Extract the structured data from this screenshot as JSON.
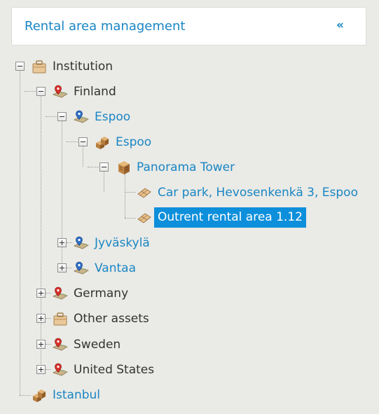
{
  "header": {
    "title": "Rental area management",
    "collapse_icon": "double-chevron-left-icon"
  },
  "tree": {
    "nodes": [
      {
        "id": "institution",
        "label": "Institution",
        "icon": "briefcase-icon",
        "expanded": true
      },
      {
        "id": "finland",
        "label": "Finland",
        "icon": "map-pin-red-icon",
        "expanded": true
      },
      {
        "id": "espoo-city",
        "label": "Espoo",
        "icon": "map-pin-blue-icon",
        "expanded": true
      },
      {
        "id": "espoo-site",
        "label": "Espoo",
        "icon": "buildings-icon",
        "expanded": true
      },
      {
        "id": "panorama-tower",
        "label": "Panorama Tower",
        "icon": "building-icon",
        "expanded": true
      },
      {
        "id": "car-park",
        "label": "Car park, Hevosenkenkä 3, Espoo",
        "icon": "floor-area-icon"
      },
      {
        "id": "outrent",
        "label": "Outrent rental area 1.12",
        "icon": "floor-area-icon",
        "selected": true
      },
      {
        "id": "jyvaskyla",
        "label": "Jyväskylä",
        "icon": "map-pin-blue-icon",
        "expanded": false
      },
      {
        "id": "vantaa",
        "label": "Vantaa",
        "icon": "map-pin-blue-icon",
        "expanded": false
      },
      {
        "id": "germany",
        "label": "Germany",
        "icon": "map-pin-red-icon",
        "expanded": false
      },
      {
        "id": "other-assets",
        "label": "Other assets",
        "icon": "briefcase-icon",
        "expanded": false
      },
      {
        "id": "sweden",
        "label": "Sweden",
        "icon": "map-pin-red-icon",
        "expanded": false
      },
      {
        "id": "united-states",
        "label": "United States",
        "icon": "map-pin-red-icon",
        "expanded": false
      },
      {
        "id": "istanbul",
        "label": "Istanbul",
        "icon": "buildings-icon"
      }
    ]
  },
  "colors": {
    "accent": "#1a86c4",
    "selected_bg": "#0d8fdb",
    "background": "#eaeae6"
  }
}
